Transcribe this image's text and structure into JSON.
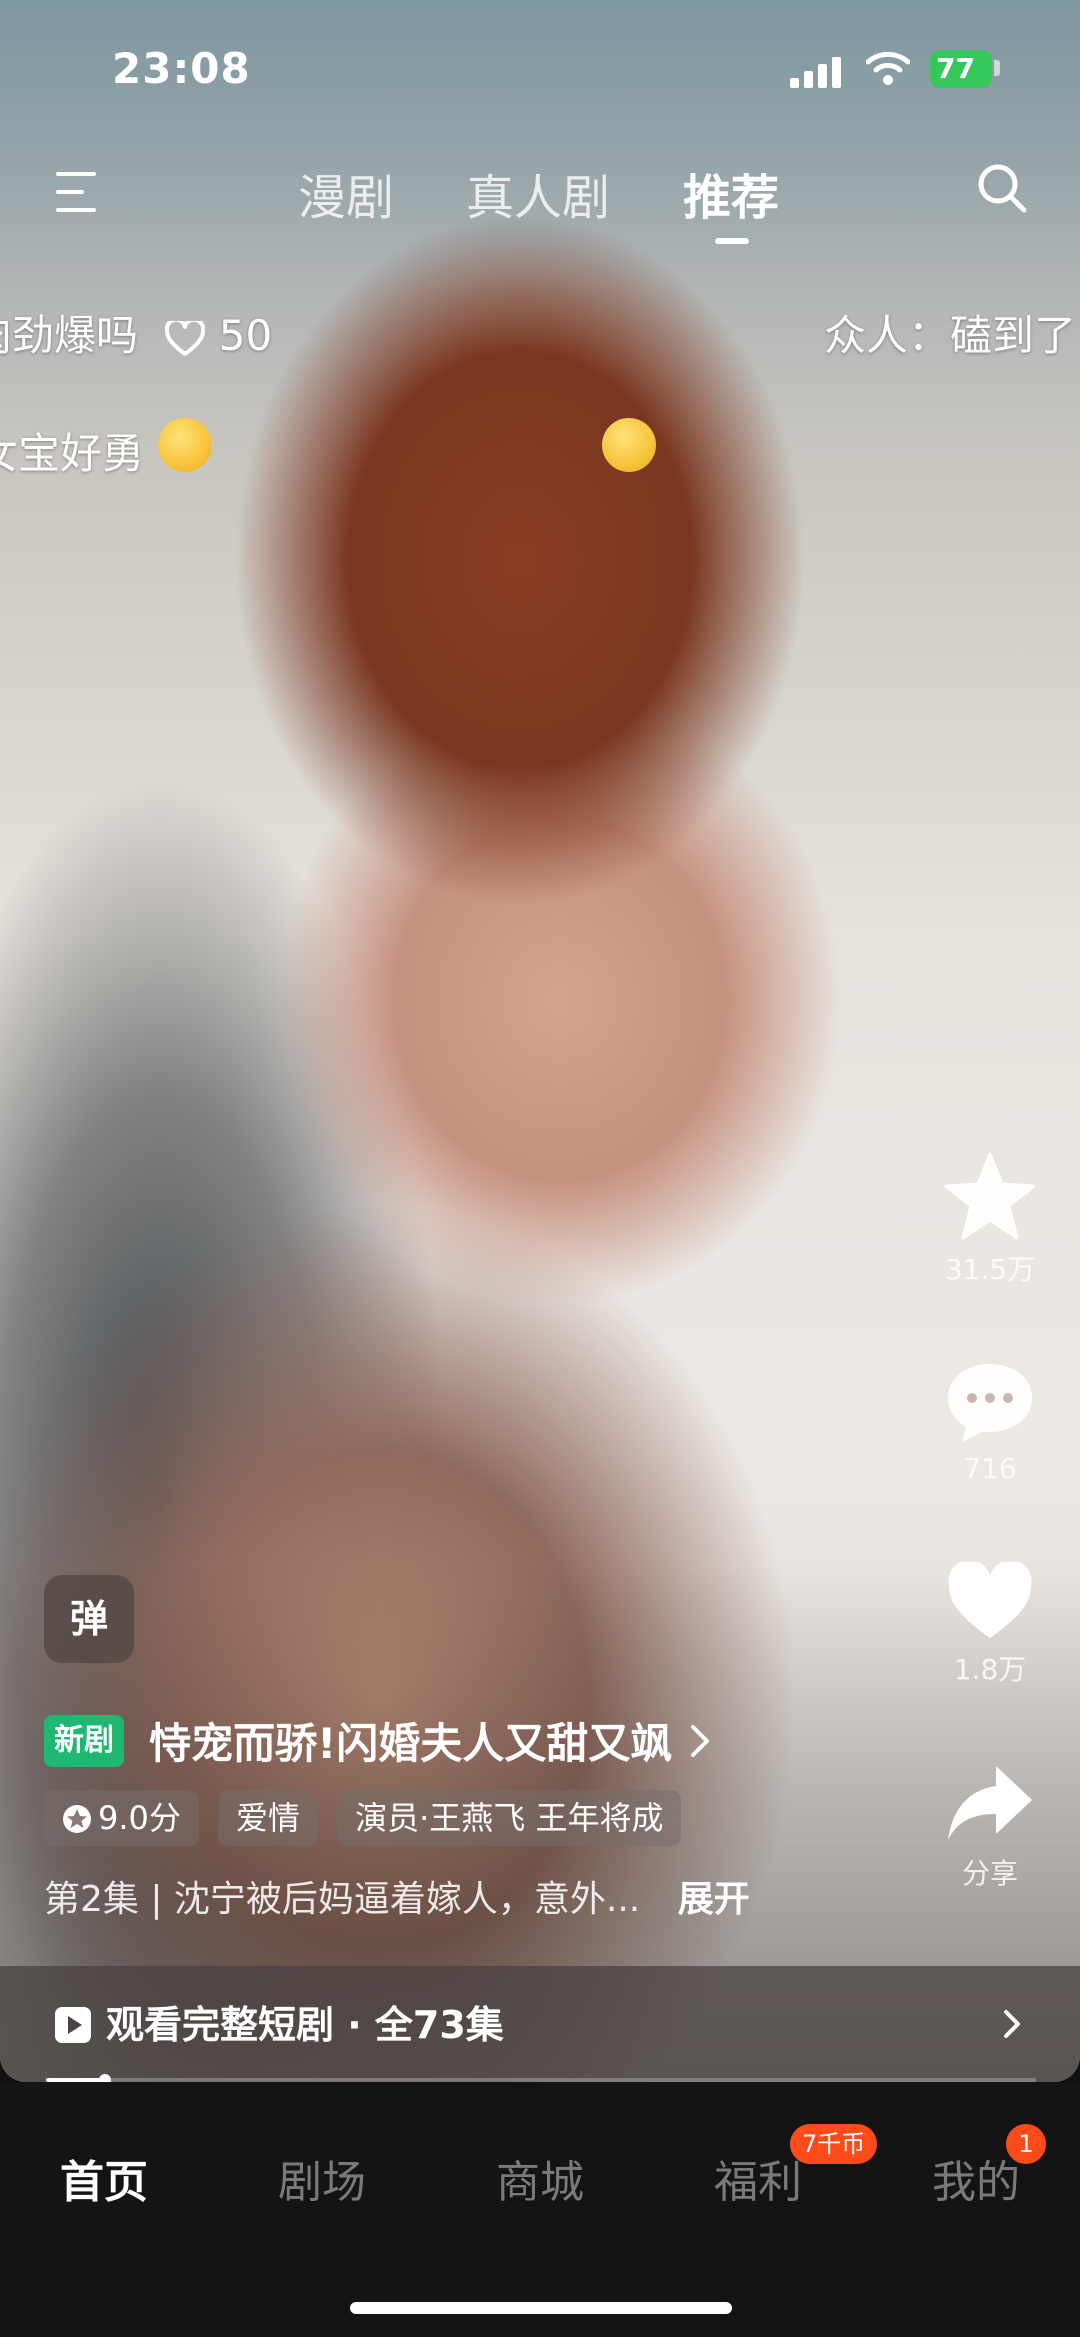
{
  "status_bar": {
    "time": "23:08",
    "battery": "77"
  },
  "top_nav": {
    "tabs": [
      {
        "label": "漫剧",
        "active": false
      },
      {
        "label": "真人剧",
        "active": false
      },
      {
        "label": "推荐",
        "active": true
      }
    ]
  },
  "danmaku": [
    {
      "text": "肉劲爆吗",
      "likes": "50"
    },
    {
      "text": "众人：磕到了"
    },
    {
      "text": "女宝好勇"
    }
  ],
  "actions": {
    "favorite_count": "31.5万",
    "comment_count": "716",
    "like_count": "1.8万",
    "share_label": "分享"
  },
  "drama": {
    "danmu_toggle": "弹",
    "new_badge": "新剧",
    "title": "恃宠而骄!闪婚夫人又甜又飒",
    "tags": [
      "9.0分",
      "爱情",
      "演员·王燕飞 王年将成"
    ],
    "description": "第2集 | 沈宁被后妈逼着嫁人，意外...",
    "expand_label": "展开"
  },
  "watch_full": {
    "label": "观看完整短剧 · 全73集",
    "progress": 0.06
  },
  "bottom_nav": {
    "items": [
      {
        "label": "首页",
        "active": true
      },
      {
        "label": "剧场",
        "active": false
      },
      {
        "label": "商城",
        "active": false
      },
      {
        "label": "福利",
        "active": false
      },
      {
        "label": "我的",
        "active": false
      }
    ],
    "coin_badge": "7千币",
    "notif_badge": "1"
  },
  "colors": {
    "accent_green": "#1fb872",
    "badge_red": "#ff4a1c",
    "battery_green": "#35c759"
  },
  "icons": [
    "menu-icon",
    "search-icon",
    "heart-outline-icon",
    "star-icon",
    "comment-icon",
    "heart-icon",
    "share-icon",
    "play-icon",
    "chevron-right-icon"
  ]
}
